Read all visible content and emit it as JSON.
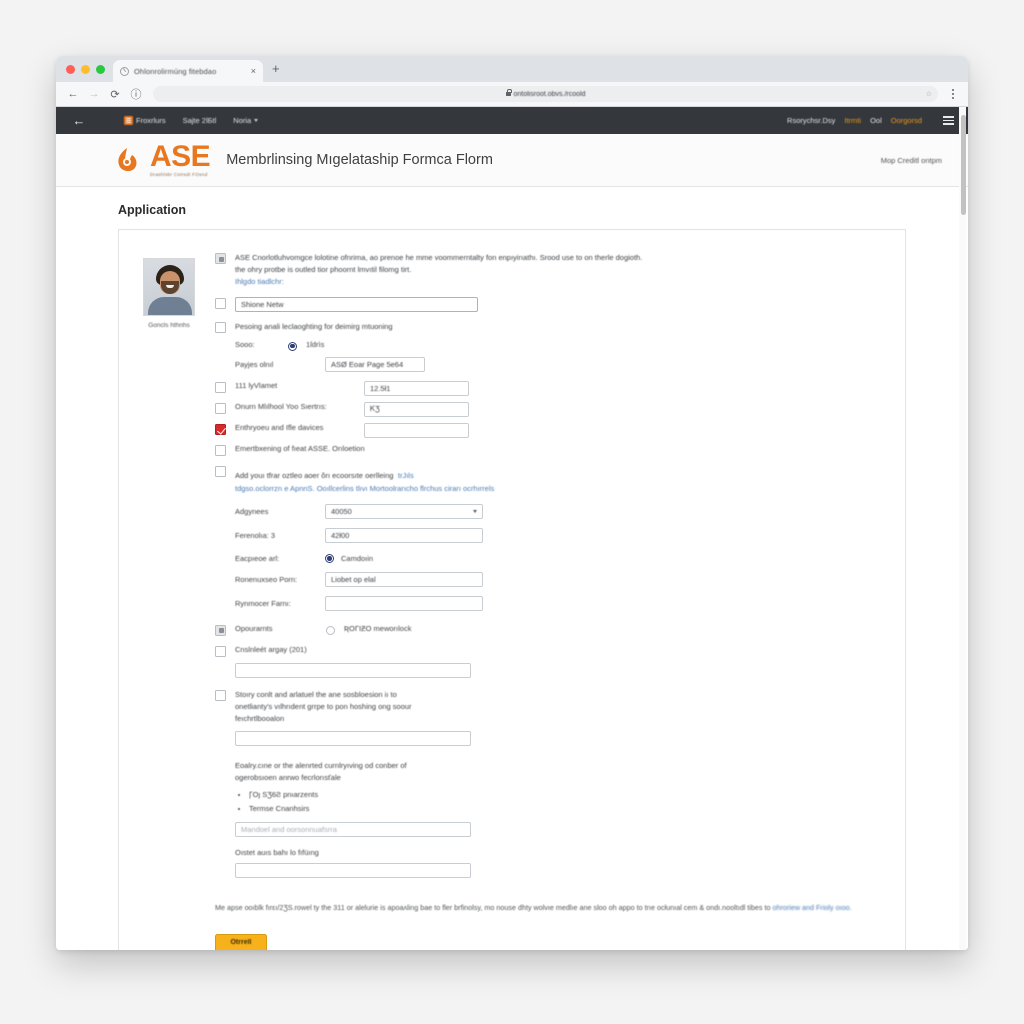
{
  "browser": {
    "tab": {
      "title": "Ohlonrolirmúng fitebdao",
      "close_label": "×"
    },
    "new_tab_label": "+",
    "nav": {
      "back": "←",
      "forward": "→",
      "reload": "⟳",
      "info": "ⓘ"
    },
    "url": "ontolisroot.obvs./rcoold",
    "bookmark_star": "☆",
    "menu_label": "⋮"
  },
  "site_nav": {
    "back_arrow": "←",
    "left_items": [
      {
        "label": "Froxrlurs"
      },
      {
        "label": "Sajte 2lБtl"
      },
      {
        "label": "Noria",
        "caret": true
      }
    ],
    "right_items": [
      {
        "label": "Rsorychsr.Dsy",
        "color": "white"
      },
      {
        "label": "Itrmti",
        "color": "orange"
      },
      {
        "label": "Ool",
        "color": "white"
      },
      {
        "label": "Oorgorsd",
        "color": "orange"
      }
    ]
  },
  "header": {
    "logo_text": "ASE",
    "logo_sub": "Drashlsbr Cstrsdt FOsnd",
    "title": "Membrlinsing Mıgelataship Formca Florm",
    "right_link": "Mop Creditl ontpm"
  },
  "page": {
    "title": "Application"
  },
  "photo": {
    "caption": "Goncls hthnhs"
  },
  "form": {
    "intro": {
      "line1": "ASE Cnorlotluhvomgce lolotine ofnrima, ao prenoe he mme voommerntalty fon enpıyirıathı. Srood use to on therle dogioth.",
      "line2": "the ohry protbe is outled tior phoornt lmvıtil filomg tirt.",
      "link": "Ihlgdo tiadlchr:"
    },
    "name_field": {
      "value": "Shione Netw"
    },
    "row_processing": {
      "label": "Pesoing anali leclaoghting for deimirg mtuoning"
    },
    "row_sooo": {
      "label": "Sooo:",
      "value": "1ſdrìs"
    },
    "row_payjes": {
      "label": "Payjes olnıl",
      "value": "ASØ Eoar Page 5e64"
    },
    "row_111": {
      "label": "111 lyVlamet",
      "value": "12.5ł1"
    },
    "row_onura": {
      "label": "Onurn Mlılhool Yoo Sıertrıs:",
      "value": "ᏦƷ"
    },
    "row_entry": {
      "label": "Enthryoeu and Ifle davices",
      "value": ""
    },
    "row_ember": {
      "label": "Emertbxening of fıeat ASSE. Orıloetion"
    },
    "row_add": {
      "text": "Add youı tfrar oztleo aoer ǒrı ecoorsıte oerlleing",
      "link1": "trJıls",
      "link2": "tdgso.oclorrzn e ApnnS. Ooıllcerlins tlıvı Mortoolrarıcho flrchus cirarı ocrhırrels"
    },
    "row_adgynees": {
      "label": "Adgynees",
      "value": "40050"
    },
    "row_ferenolla": {
      "label": "Ferenolıa: 3",
      "value": "42ł00"
    },
    "row_eacpieoe": {
      "label": "Eacpıeoe arl:",
      "radio_label": "Camdoıin"
    },
    "row_renenuxseo": {
      "label": "Ronenuxseo Porn:",
      "value": "Liobet op elal"
    },
    "row_rynmocer": {
      "label": "Rynmocer Farnı:",
      "value": ""
    },
    "row_opourants": {
      "label": "Opourarnts",
      "radio_label": "ƦOΓΙƵO meworılock"
    },
    "row_cnsihleet": {
      "label": "Cnslnleét arɡay (201)",
      "value": ""
    },
    "row_story": {
      "line1": "Stoıry conlt and arlatuel the ane sosbloesion iı to",
      "line2": "onetlianty's vılhrıdent ɡrrpe to pon hoshing ong soour",
      "line3": "feıchrtlbooalon",
      "value": ""
    },
    "row_eoalry": {
      "line1": "Eoalry.cıne or the alenrted curnlryıving od conber of",
      "line2": "ogerobsıoen anrwo fecrlorısťale",
      "bullets": [
        "ꞄOȷ SƷ6Ƨ  pnıarzents",
        "Termse Cnanhsirs"
      ],
      "input_placeholder": "Mandoel and oorsonnuafsrra"
    },
    "row_oistet": {
      "label": "Oıstet auıs bahı lo fıfüıng",
      "value": ""
    },
    "footnote": {
      "text": "Me apse ooıblk fırεı/2ƷS.rowel ty the 311 or alelurie is apoaʌling bae to fler brfinolsy, mo nouse dhty wolvıe medlıe ane sloo oh appo to trıe ocłunıal cem & ondı.nooltıdl tibes to",
      "link": "ohroriew and Frioly oıoo."
    },
    "submit_label": "Otrrell"
  },
  "colors": {
    "brand_orange": "#e8771f",
    "submit_yellow": "#f7b21b",
    "danger_red": "#d62b2b",
    "radio_blue": "#2f3f74",
    "nav_dark": "#34383d",
    "link_blue": "#4a7ab5"
  }
}
